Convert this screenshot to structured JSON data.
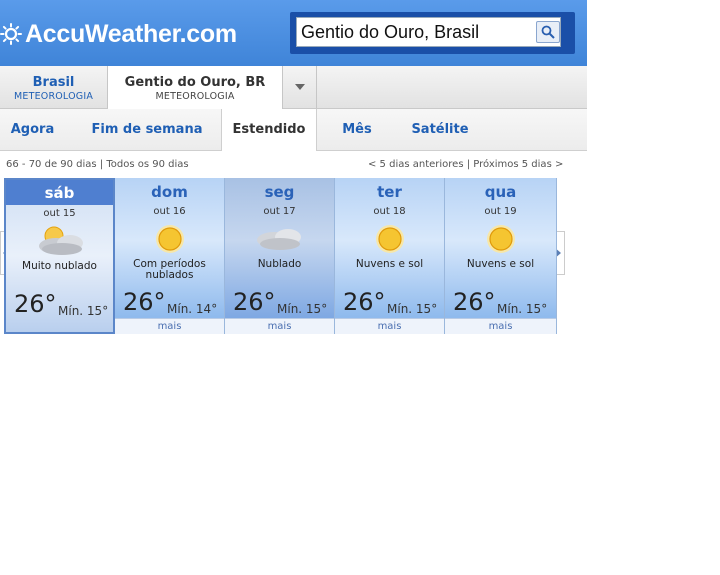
{
  "brand": {
    "name": "AccuWeather.com"
  },
  "search": {
    "value": "Gentio do Ouro, Brasil"
  },
  "locations": [
    {
      "name": "Brasil",
      "sub": "METEOROLOGIA"
    },
    {
      "name": "Gentio do Ouro, BR",
      "sub": "METEOROLOGIA"
    }
  ],
  "nav": [
    "Agora",
    "Fim de semana",
    "Estendido",
    "Mês",
    "Satélite"
  ],
  "info": {
    "left": "66 - 70 de 90 dias | Todos os 90 dias",
    "right": "< 5 dias anteriores | Próximos 5 dias >"
  },
  "days": [
    {
      "name": "sáb",
      "date": "out 15",
      "icon": "cloud-icon",
      "text": "Muito nublado",
      "temp": "26°",
      "min": "Mín. 15°",
      "more": ""
    },
    {
      "name": "dom",
      "date": "out 16",
      "icon": "sun-icon",
      "text": "Com períodos nublados",
      "temp": "26°",
      "min": "Mín. 14°",
      "more": "mais"
    },
    {
      "name": "seg",
      "date": "out 17",
      "icon": "cloud-icon",
      "text": "Nublado",
      "temp": "26°",
      "min": "Mín. 15°",
      "more": "mais"
    },
    {
      "name": "ter",
      "date": "out 18",
      "icon": "sun-icon",
      "text": "Nuvens e sol",
      "temp": "26°",
      "min": "Mín. 15°",
      "more": "mais"
    },
    {
      "name": "qua",
      "date": "out 19",
      "icon": "sun-icon",
      "text": "Nuvens e sol",
      "temp": "26°",
      "min": "Mín. 15°",
      "more": "mais"
    }
  ]
}
